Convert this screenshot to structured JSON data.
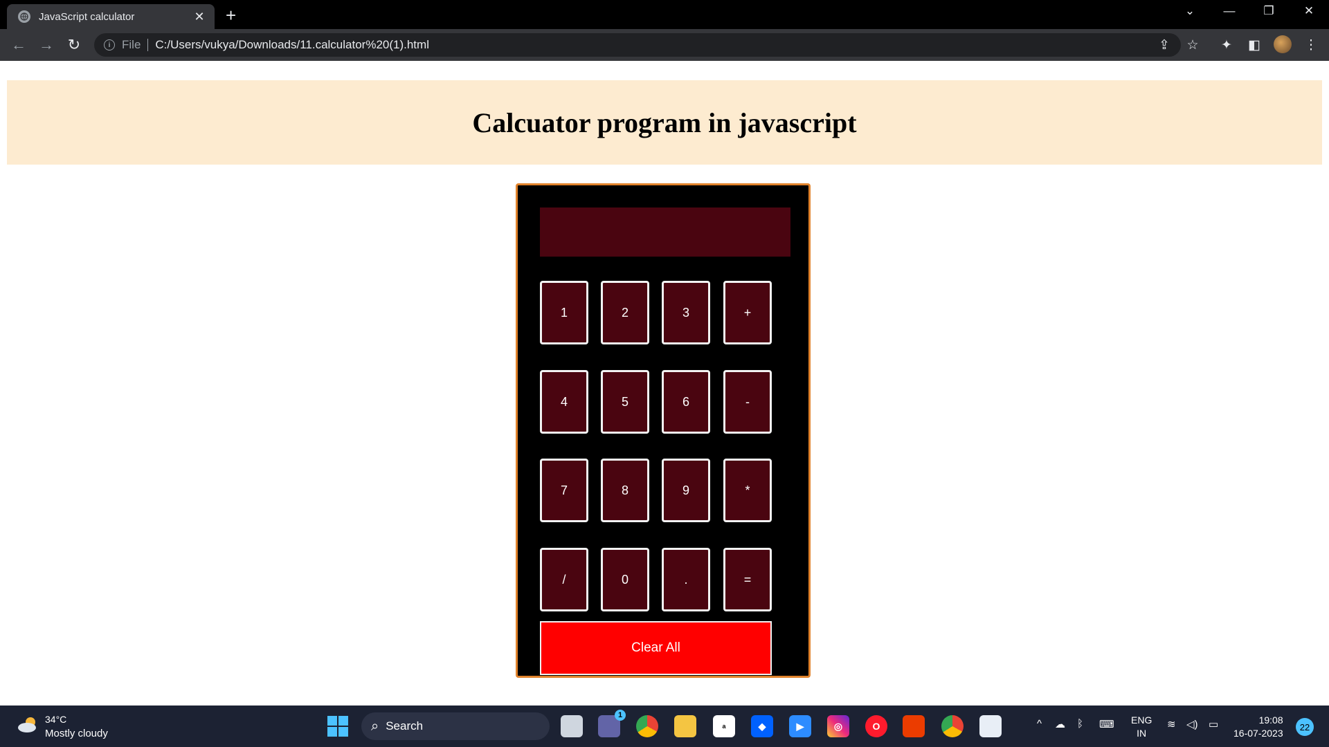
{
  "browser": {
    "tab_title": "JavaScript calculator",
    "tab_close": "✕",
    "new_tab": "+",
    "file_label": "File",
    "url": "C:/Users/vukya/Downloads/11.calculator%20(1).html"
  },
  "page": {
    "title": "Calcuator program in javascript"
  },
  "calculator": {
    "display_value": "",
    "keys": [
      "1",
      "2",
      "3",
      "+",
      "4",
      "5",
      "6",
      "-",
      "7",
      "8",
      "9",
      "*",
      "/",
      "0",
      ".",
      "="
    ],
    "clear_label": "Clear All",
    "colors": {
      "body": "#000000",
      "border": "#e0822b",
      "key": "#4a0510",
      "clear": "#ff0000"
    }
  },
  "taskbar": {
    "weather_temp": "34°C",
    "weather_desc": "Mostly cloudy",
    "search_label": "Search",
    "lang_top": "ENG",
    "lang_bottom": "IN",
    "time": "19:08",
    "date": "16-07-2023",
    "notification_count": "22",
    "teams_badge": "1"
  }
}
